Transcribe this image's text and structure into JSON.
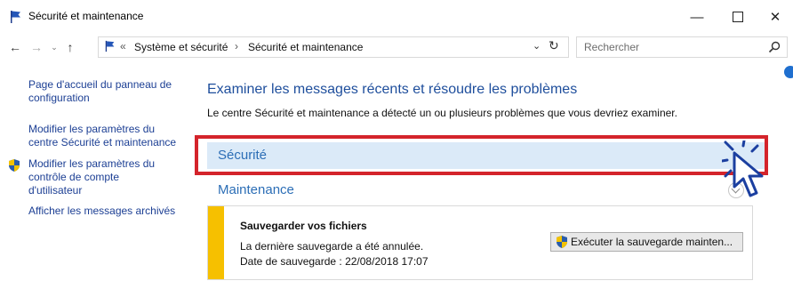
{
  "window": {
    "title": "Sécurité et maintenance",
    "controls": {
      "minimize": "—",
      "close": "✕"
    }
  },
  "address_bar": {
    "overflow": "«",
    "crumbs": [
      "Système et sécurité",
      "Sécurité et maintenance"
    ],
    "separator": "›",
    "dropdown": "⌄",
    "refresh": "↻"
  },
  "nav": {
    "back": "←",
    "forward": "→",
    "history": "⌄",
    "up": "↑"
  },
  "search": {
    "placeholder": "Rechercher"
  },
  "left_pane": {
    "links": [
      "Page d'accueil du panneau de configuration",
      "Modifier les paramètres du centre Sécurité et maintenance",
      "Modifier les paramètres du contrôle de compte d'utilisateur",
      "Afficher les messages archivés"
    ]
  },
  "main": {
    "title": "Examiner les messages récents et résoudre les problèmes",
    "description": "Le centre Sécurité et maintenance a détecté un ou plusieurs problèmes que vous devriez examiner.",
    "sections": {
      "security": "Sécurité",
      "maintenance": "Maintenance"
    },
    "backup_card": {
      "title": "Sauvegarder vos fichiers",
      "line1": "La dernière sauvegarde a été annulée.",
      "line2": "Date de sauvegarde : 22/08/2018 17:07",
      "button": "Exécuter la sauvegarde mainten..."
    }
  },
  "colors": {
    "accent_blue": "#2c6eb6",
    "highlight_red": "#d4242b",
    "warning_yellow": "#f6c000",
    "section_bg": "#dbeaf8"
  }
}
